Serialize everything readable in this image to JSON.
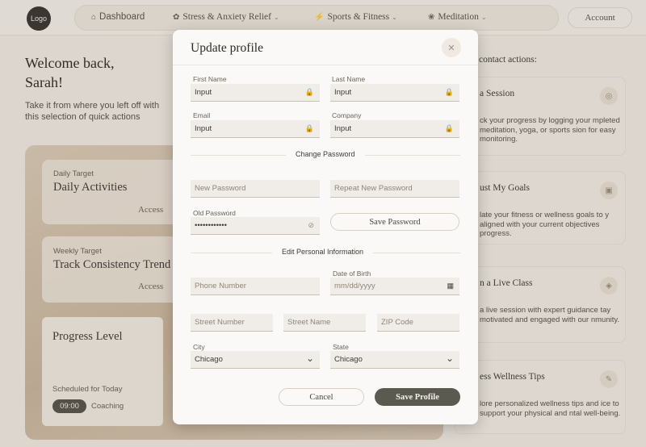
{
  "nav": {
    "logo": "Logo",
    "items": [
      {
        "label": "Dashboard",
        "icon": "home-icon",
        "glyph": "⌂",
        "chevron": ""
      },
      {
        "label": "Stress & Anxiety Relief",
        "icon": "leaf-icon",
        "glyph": "✿",
        "chevron": "⌄"
      },
      {
        "label": "Sports & Fitness",
        "icon": "pulse-icon",
        "glyph": "⚡",
        "chevron": "⌄"
      },
      {
        "label": "Meditation",
        "icon": "lotus-icon",
        "glyph": "❀",
        "chevron": "⌄"
      }
    ],
    "account": "Account"
  },
  "page": {
    "welcome_line1": "Welcome back,",
    "welcome_line2": "Sarah!",
    "intro": "Take it from where you left off with this selection of quick actions",
    "cards": [
      {
        "label": "Daily Target",
        "title": "Daily Activities",
        "action": "Access"
      },
      {
        "label": "Weekly Target",
        "title": "Track Consistency Trend",
        "action": "Access"
      }
    ],
    "progress": {
      "title": "Progress Level",
      "scheduled": "Scheduled for Today",
      "time": "09:00",
      "activity": "Coaching"
    },
    "quick_title": "contact actions:",
    "quick_cards": [
      {
        "title": "a Session",
        "desc": "ck your progress by logging your mpleted meditation, yoga, or sports sion for easy monitoring."
      },
      {
        "title": "ust My Goals",
        "desc": "late your fitness or wellness goals to y aligned with your current objectives progress."
      },
      {
        "title": "n a Live Class",
        "desc": "a live session with expert guidance tay motivated and engaged with our nmunity."
      },
      {
        "title": "ess Wellness Tips",
        "desc": "lore personalized wellness tips and ice to support your physical and ntal well-being."
      }
    ]
  },
  "modal": {
    "title": "Update profile",
    "close_glyph": "✕",
    "first_name": {
      "label": "First Name",
      "value": "Input"
    },
    "last_name": {
      "label": "Last Name",
      "value": "Input"
    },
    "email": {
      "label": "Email",
      "value": "Input"
    },
    "company": {
      "label": "Company",
      "value": "Input"
    },
    "lock_glyph": "🔒",
    "change_password_heading": "Change Password",
    "new_password_placeholder": "New Password",
    "repeat_password_placeholder": "Repeat New Password",
    "old_password": {
      "label": "Old Password",
      "value": "••••••••••••"
    },
    "eye_glyph": "⊘",
    "save_password": "Save Password",
    "personal_info_heading": "Edit Personal Information",
    "phone_placeholder": "Phone Number",
    "dob": {
      "label": "Date of Birth",
      "placeholder": "mm/dd/yyyy"
    },
    "calendar_glyph": "▦",
    "street_number_placeholder": "Street Number",
    "street_name_placeholder": "Street Name",
    "zip_placeholder": "ZIP Code",
    "city": {
      "label": "City",
      "value": "Chicago"
    },
    "state": {
      "label": "State",
      "value": "Chicago"
    },
    "chevron_glyph": "⌄",
    "cancel": "Cancel",
    "save_profile": "Save Profile"
  }
}
